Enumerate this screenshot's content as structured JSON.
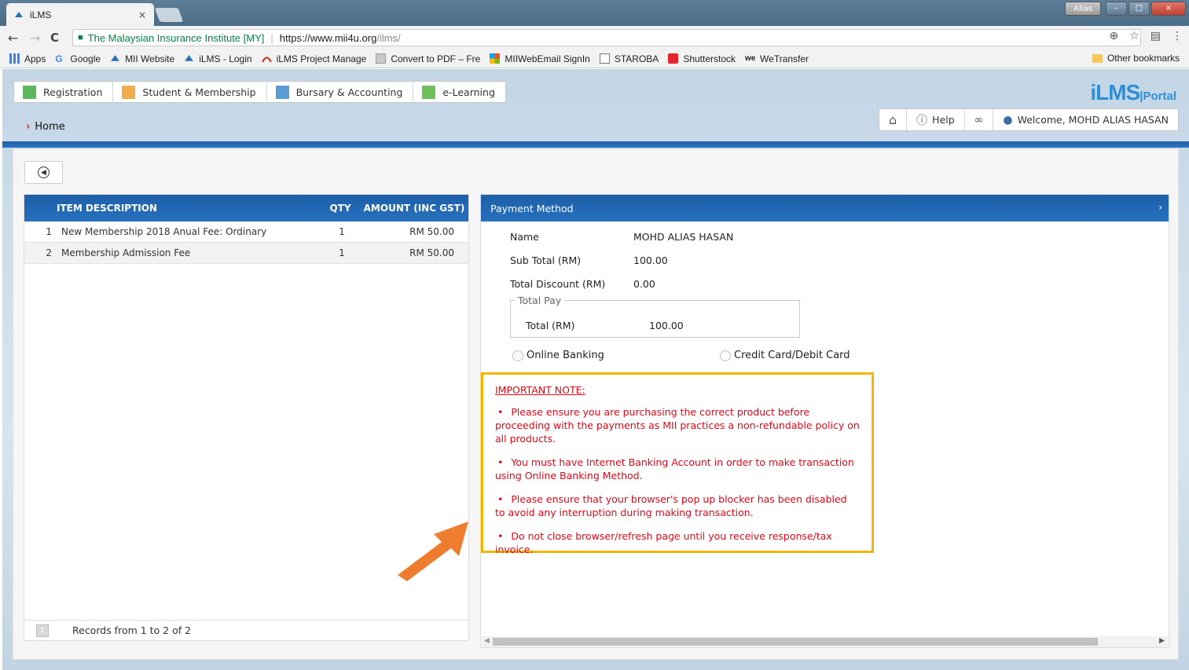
{
  "browser": {
    "tab_title": "iLMS",
    "tab_close": "×",
    "window_user": "Alias",
    "win_min": "–",
    "win_max": "□",
    "win_close": "×",
    "back": "←",
    "forward": "→",
    "reload": "C",
    "secure_label": "The Malaysian Insurance Institute [MY]",
    "url_host": "https://www.mii4u.org",
    "url_path": "/ilms/",
    "bookmarks": [
      "Apps",
      "Google",
      "MII Website",
      "iLMS - Login",
      "iLMS Project Manage",
      "Convert to PDF – Fre",
      "MIIWebEmail SignIn",
      "STAROBA",
      "Shutterstock",
      "WeTransfer"
    ],
    "other_bookmarks": "Other bookmarks"
  },
  "header": {
    "modules": [
      {
        "label": "Registration",
        "color": "#5cb85c"
      },
      {
        "label": "Student & Membership",
        "color": "#f0ad4e"
      },
      {
        "label": "Bursary & Accounting",
        "color": "#5b9bd5"
      },
      {
        "label": "e-Learning",
        "color": "#6fbf5a"
      }
    ],
    "logo_main": "iLMS",
    "logo_sub": "|Portal",
    "breadcrumb": "Home",
    "help_label": "Help",
    "welcome": "Welcome, MOHD ALIAS HASAN"
  },
  "items_table": {
    "headers": {
      "description": "ITEM DESCRIPTION",
      "qty": "QTY",
      "amount": "AMOUNT (INC GST)"
    },
    "rows": [
      {
        "no": "1",
        "description": "New Membership 2018 Anual Fee: Ordinary",
        "qty": "1",
        "amount": "RM 50.00"
      },
      {
        "no": "2",
        "description": "Membership Admission Fee",
        "qty": "1",
        "amount": "RM 50.00"
      }
    ],
    "page_number": "1",
    "footer": "Records from 1 to 2 of 2"
  },
  "payment": {
    "title": "Payment Method",
    "name_label": "Name",
    "name_value": "MOHD ALIAS HASAN",
    "subtotal_label": "Sub Total (RM)",
    "subtotal_value": "100.00",
    "discount_label": "Total Discount (RM)",
    "discount_value": "0.00",
    "totalpay_legend": "Total Pay",
    "total_label": "Total (RM)",
    "total_value": "100.00",
    "option_online": "Online Banking",
    "option_card": "Credit Card/Debit Card"
  },
  "note": {
    "heading": "IMPORTANT NOTE:",
    "items": [
      "Please ensure you are purchasing the correct product before proceeding with the payments as MII practices a non-refundable policy on all products.",
      "You must have Internet Banking Account in order to make transaction using Online Banking Method.",
      "Please ensure that your browser's pop up blocker has been disabled to avoid any interruption during making transaction.",
      "Do not close browser/refresh page until you receive response/tax invoice."
    ]
  },
  "colors": {
    "header_blue": "#2771bf",
    "note_border": "#f5b400",
    "note_text": "#e0091a",
    "callout_arrow": "#ef7d2f"
  }
}
